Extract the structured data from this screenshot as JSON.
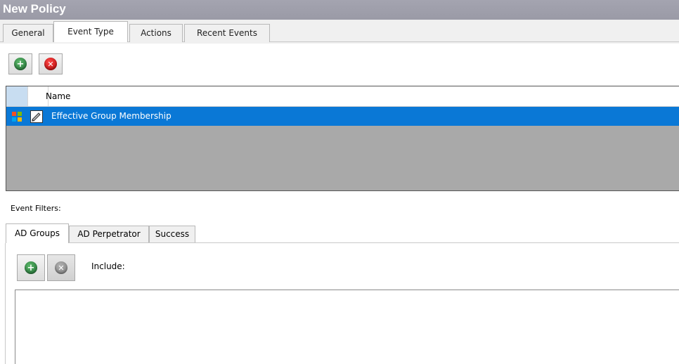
{
  "window": {
    "title": "New Policy"
  },
  "tabs": [
    {
      "label": "General"
    },
    {
      "label": "Event Type"
    },
    {
      "label": "Actions"
    },
    {
      "label": "Recent Events"
    }
  ],
  "toolbar": {
    "add_icon": "add-circle-icon",
    "remove_icon": "remove-circle-icon"
  },
  "grid": {
    "columns": [
      "",
      "",
      "Name"
    ],
    "rows": [
      {
        "name": "Effective Group Membership",
        "selected": true
      }
    ]
  },
  "event_filters": {
    "label": "Event Filters:",
    "tabs": [
      {
        "label": "AD Groups"
      },
      {
        "label": "AD Perpetrator"
      },
      {
        "label": "Success"
      }
    ],
    "include_label": "Include:"
  },
  "colors": {
    "selection": "#0a78d6",
    "header_selector": "#c8ddf1",
    "grid_empty": "#a9a9a9",
    "add_green": "#2e8b45",
    "remove_red": "#d40000"
  }
}
